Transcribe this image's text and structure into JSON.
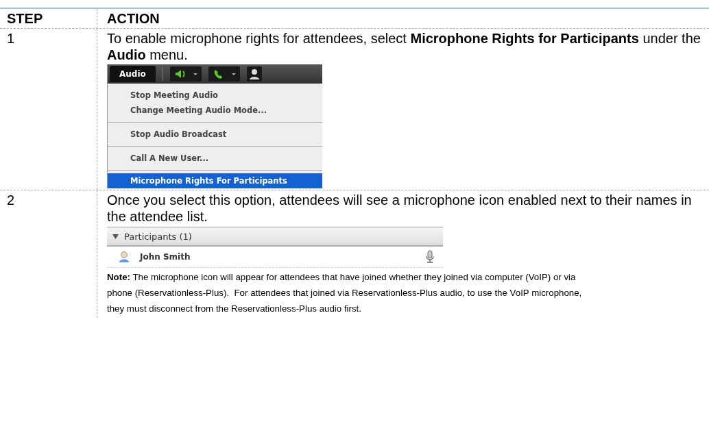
{
  "table": {
    "columns": [
      "STEP",
      "ACTION"
    ],
    "rows": [
      {
        "kind": "menu",
        "step": "1",
        "text": "To enable microphone rights for attendees, select **Microphone Rights for Participants** under the **Audio** menu.",
        "menu": {
          "title": "Audio",
          "groups": [
            [
              {
                "label": "Stop Meeting Audio",
                "selected": false
              },
              {
                "label": "Change Meeting Audio Mode...",
                "selected": false
              }
            ],
            [
              {
                "label": "Stop Audio Broadcast",
                "selected": false
              }
            ],
            [
              {
                "label": "Call A New User...",
                "selected": false
              }
            ],
            [
              {
                "label": "Microphone Rights For Participants",
                "selected": true
              }
            ]
          ]
        }
      },
      {
        "kind": "participants",
        "step": "2",
        "text": "Once you select this option, attendees will see a microphone icon enabled next to their names in the attendee list.",
        "panel": {
          "title": "Participants (1)",
          "expanded": true,
          "people": [
            {
              "name": "John Smith",
              "microphone": true
            }
          ]
        },
        "note": "**Note:** The microphone icon will appear for attendees that have joined whether they joined via computer (VoIP) or via phone (Reservationless-Plus).  For attendees that joined via Reservationless-Plus audio, to use the VoIP microphone, they must disconnect from the Reservationless-Plus audio first."
      }
    ]
  }
}
